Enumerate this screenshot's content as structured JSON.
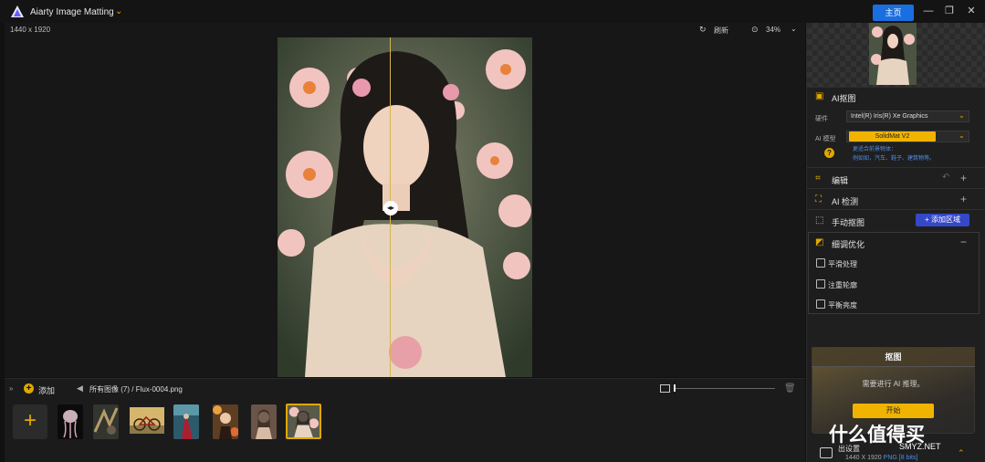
{
  "titlebar": {
    "app_title": "Aiarty Image Matting",
    "home_label": "主页"
  },
  "canvas": {
    "image_size": "1440 x 1920",
    "refresh_label": "刷新",
    "zoom_label": "34%"
  },
  "bottom": {
    "add_label": "添加",
    "breadcrumb_all": "所有图像 (7)",
    "breadcrumb_sep": "/",
    "breadcrumb_file": "Flux-0004.png",
    "thumbnails": [
      "thumb-jellyfish",
      "thumb-graffiti",
      "thumb-bicycle",
      "thumb-woman-red",
      "thumb-girl-flowers",
      "thumb-woman-portrait",
      "thumb-selected"
    ]
  },
  "panel": {
    "ai_matting_title": "AI抠图",
    "hardware_label": "硬件",
    "hardware_value": "Intel(R) Iris(R) Xe Graphics",
    "model_label": "AI 模型",
    "model_value": "SolidMat  V2",
    "model_hint_1": "更适合前景物体：",
    "model_hint_2": "例如如，汽车、鞋子、建筑物等。",
    "edit_title": "编辑",
    "ai_detect_title": "AI 检测",
    "manual_title": "手动抠图",
    "add_region_label": "+ 添加区域",
    "refine_title": "细调优化",
    "options": [
      "平滑处理",
      "注重轮廓",
      "平衡亮度"
    ],
    "matting_title": "抠图",
    "matting_msg": "需要进行 AI 推理。",
    "start_label": "开始",
    "output_label": "出设置",
    "output_size": "1440 X 1920",
    "output_format": "PNG",
    "output_bits": "[8 bits]"
  },
  "watermark": {
    "text": "什么值得买",
    "sub": "SMYZ.NET"
  },
  "colors": {
    "accent": "#e0a800",
    "home": "#1a6fe0",
    "add_region": "#3548c8"
  }
}
